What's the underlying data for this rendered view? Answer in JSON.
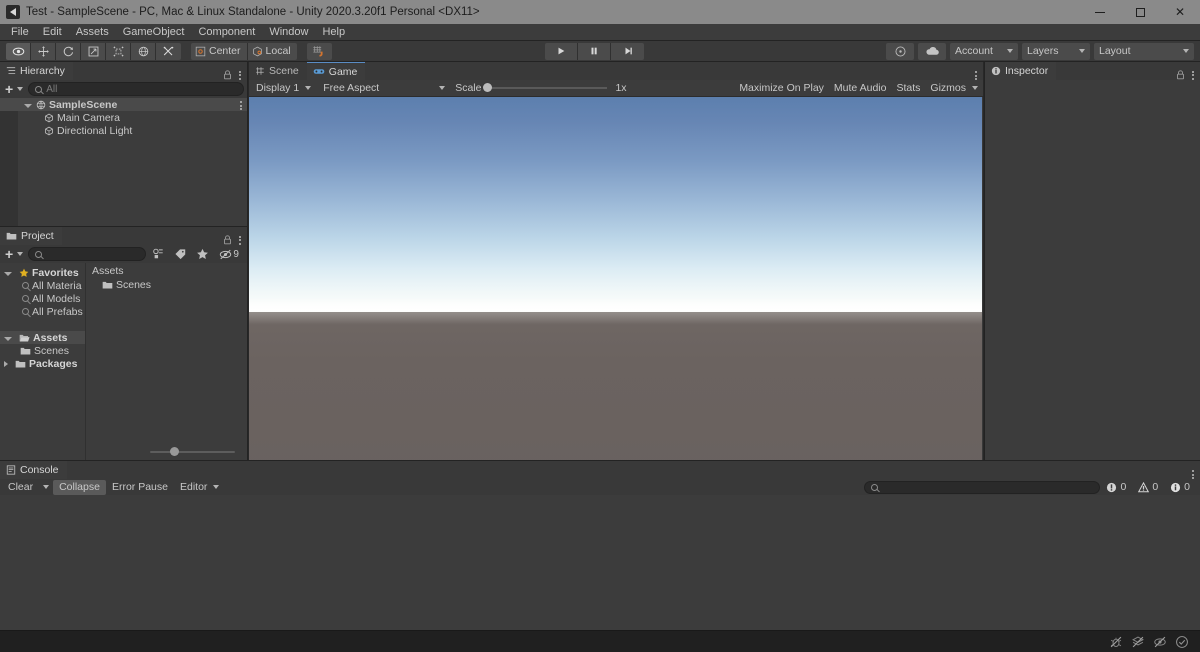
{
  "window": {
    "title": "Test - SampleScene - PC, Mac & Linux Standalone - Unity 2020.3.20f1 Personal <DX11>",
    "minimize": "–",
    "maximize": "□",
    "close": "✕"
  },
  "menubar": {
    "items": [
      "File",
      "Edit",
      "Assets",
      "GameObject",
      "Component",
      "Window",
      "Help"
    ]
  },
  "toolbar": {
    "tools": [
      {
        "name": "hand-tool",
        "icon": "eye-icon",
        "active": true
      },
      {
        "name": "move-tool",
        "icon": "move-icon",
        "active": false
      },
      {
        "name": "rotate-tool",
        "icon": "rotate-icon",
        "active": false
      },
      {
        "name": "scale-tool",
        "icon": "scale-icon",
        "active": false
      },
      {
        "name": "rect-tool",
        "icon": "rect-icon",
        "active": false
      },
      {
        "name": "transform-tool",
        "icon": "transform-icon",
        "active": false
      },
      {
        "name": "custom-tool",
        "icon": "wrench-icon",
        "active": false
      }
    ],
    "pivot_mode": "Center",
    "pivot_rotation": "Local",
    "snap_label": "grid-snap-icon",
    "play": "play-icon",
    "pause": "pause-icon",
    "step": "step-icon",
    "collab_icon": "collab-icon",
    "cloud_icon": "cloud-icon",
    "account": "Account",
    "layers": "Layers",
    "layout": "Layout"
  },
  "hierarchy": {
    "tab_label": "Hierarchy",
    "search_placeholder": "All",
    "add_label": "+",
    "rows": [
      {
        "label": "SampleScene",
        "depth": 0,
        "icon": "scene-icon",
        "selected": true,
        "expanded": true
      },
      {
        "label": "Main Camera",
        "depth": 1,
        "icon": "gameobject-icon",
        "selected": false
      },
      {
        "label": "Directional Light",
        "depth": 1,
        "icon": "gameobject-icon",
        "selected": false
      }
    ]
  },
  "project": {
    "tab_label": "Project",
    "search_placeholder": "",
    "hidden_count": "9",
    "breadcrumb": "Assets",
    "tree": [
      {
        "label": "Favorites",
        "depth": 0,
        "icon": "star-icon",
        "bold": true,
        "expanded": true
      },
      {
        "label": "All Materia",
        "depth": 1,
        "icon": "search-icon",
        "bold": false
      },
      {
        "label": "All Models",
        "depth": 1,
        "icon": "search-icon",
        "bold": false
      },
      {
        "label": "All Prefabs",
        "depth": 1,
        "icon": "search-icon",
        "bold": false
      },
      {
        "label": "Assets",
        "depth": 0,
        "icon": "folder-open-icon",
        "bold": true,
        "expanded": true,
        "selected": true
      },
      {
        "label": "Scenes",
        "depth": 1,
        "icon": "folder-icon",
        "bold": false
      },
      {
        "label": "Packages",
        "depth": 0,
        "icon": "folder-icon",
        "bold": true,
        "expanded": false
      }
    ],
    "contents": [
      {
        "label": "Scenes",
        "icon": "folder-icon"
      }
    ]
  },
  "gameview": {
    "tabs": [
      {
        "label": "Scene",
        "icon": "scene-tab-icon",
        "active": false
      },
      {
        "label": "Game",
        "icon": "game-tab-icon",
        "active": true
      }
    ],
    "display": "Display 1",
    "aspect": "Free Aspect",
    "scale_label": "Scale",
    "scale_value": "1x",
    "maximize_on_play": "Maximize On Play",
    "mute_audio": "Mute Audio",
    "stats": "Stats",
    "gizmos": "Gizmos"
  },
  "inspector": {
    "tab_label": "Inspector"
  },
  "console": {
    "tab_label": "Console",
    "clear": "Clear",
    "collapse": "Collapse",
    "error_pause": "Error Pause",
    "editor": "Editor",
    "search_placeholder": "",
    "counts": {
      "error": "0",
      "warning": "0",
      "info": "0"
    }
  },
  "statusbar": {
    "icons": [
      "bug-off-icon",
      "layers-off-icon",
      "eye-off-icon",
      "check-circle-icon"
    ]
  },
  "colors": {
    "accent_blue": "#5a8cc4",
    "panel_bg": "#3c3c3c",
    "chrome_bg": "#393939",
    "titlebar": "#8a8a8a",
    "sky_top": "#5c7fae",
    "ground": "#6b6360",
    "orange": "#d06a2c"
  }
}
